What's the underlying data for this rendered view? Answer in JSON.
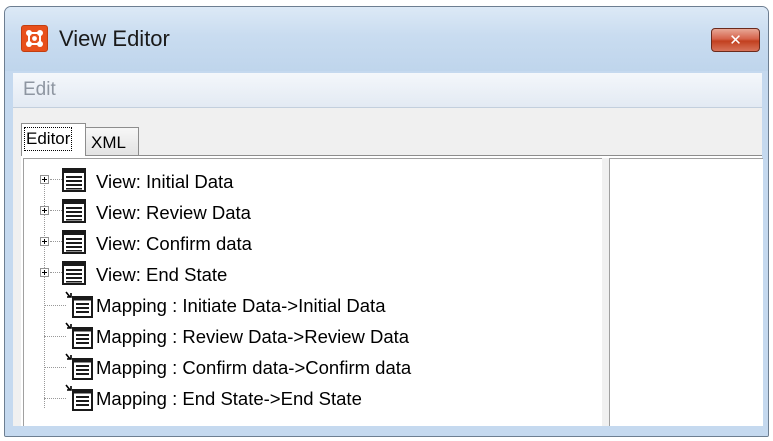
{
  "window": {
    "title": "View Editor",
    "close_symbol": "✕",
    "app_icon": "app-grid-icon"
  },
  "menu": {
    "items": [
      {
        "label": "Edit"
      }
    ]
  },
  "tabs": [
    {
      "label": "Editor",
      "active": true
    },
    {
      "label": "XML",
      "active": false
    }
  ],
  "tree": {
    "items": [
      {
        "label": "View: Initial Data",
        "type": "view",
        "expandable": true
      },
      {
        "label": "View: Review Data",
        "type": "view",
        "expandable": true
      },
      {
        "label": "View: Confirm data",
        "type": "view",
        "expandable": true
      },
      {
        "label": "View: End State",
        "type": "view",
        "expandable": true
      },
      {
        "label": "Mapping : Initiate Data->Initial Data",
        "type": "mapping",
        "expandable": false
      },
      {
        "label": "Mapping : Review Data->Review Data",
        "type": "mapping",
        "expandable": false
      },
      {
        "label": "Mapping : Confirm data->Confirm data",
        "type": "mapping",
        "expandable": false
      },
      {
        "label": "Mapping : End State->End State",
        "type": "mapping",
        "expandable": false
      }
    ]
  },
  "colors": {
    "title_bar": "#c9dcf0",
    "close_button": "#c2401f",
    "app_icon": "#e8501b"
  }
}
